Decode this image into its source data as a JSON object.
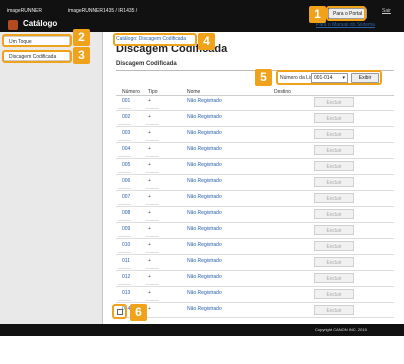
{
  "header": {
    "product": "imageRUNNER",
    "device": "imageRUNNER1435 / IR1435 /",
    "app_title": "Catálogo",
    "portal_button": "Para o Portal",
    "exit_link": "Sair",
    "manual_link": "Para o Manual do Sistema"
  },
  "sidebar": {
    "items": [
      {
        "label": "Um Toque"
      },
      {
        "label": "Discagem Codificada"
      }
    ]
  },
  "main": {
    "breadcrumb": "Catálogo: Discagem Codificada",
    "title": "Discagem Codificada",
    "section_title": "Discagem Codificada",
    "list_label": "Número da Lista:",
    "list_value": "001-014",
    "list_arrow": "▾",
    "exibir": "Exibir",
    "columns": [
      "Número",
      "Tipo",
      "Nome",
      "Destino"
    ],
    "rows": [
      {
        "number": "001",
        "type": "+",
        "name": "Não Registrado",
        "action": "Excluir"
      },
      {
        "number": "002",
        "type": "+",
        "name": "Não Registrado",
        "action": "Excluir"
      },
      {
        "number": "003",
        "type": "+",
        "name": "Não Registrado",
        "action": "Excluir"
      },
      {
        "number": "004",
        "type": "+",
        "name": "Não Registrado",
        "action": "Excluir"
      },
      {
        "number": "005",
        "type": "+",
        "name": "Não Registrado",
        "action": "Excluir"
      },
      {
        "number": "006",
        "type": "+",
        "name": "Não Registrado",
        "action": "Excluir"
      },
      {
        "number": "007",
        "type": "+",
        "name": "Não Registrado",
        "action": "Excluir"
      },
      {
        "number": "008",
        "type": "+",
        "name": "Não Registrado",
        "action": "Excluir"
      },
      {
        "number": "009",
        "type": "+",
        "name": "Não Registrado",
        "action": "Excluir"
      },
      {
        "number": "010",
        "type": "+",
        "name": "Não Registrado",
        "action": "Excluir"
      },
      {
        "number": "011",
        "type": "+",
        "name": "Não Registrado",
        "action": "Excluir"
      },
      {
        "number": "012",
        "type": "+",
        "name": "Não Registrado",
        "action": "Excluir"
      },
      {
        "number": "013",
        "type": "+",
        "name": "Não Registrado",
        "action": "Excluir"
      },
      {
        "number": "014",
        "type": "+",
        "name": "Não Registrado",
        "action": "Excluir"
      }
    ]
  },
  "footer": {
    "copyright": "Copyright CANON INC. 2015"
  },
  "callouts": [
    "1",
    "2",
    "3",
    "4",
    "5",
    "6"
  ],
  "colors": {
    "callout": "#f0a21a",
    "link": "#2a62a8",
    "topbar": "#111111"
  }
}
